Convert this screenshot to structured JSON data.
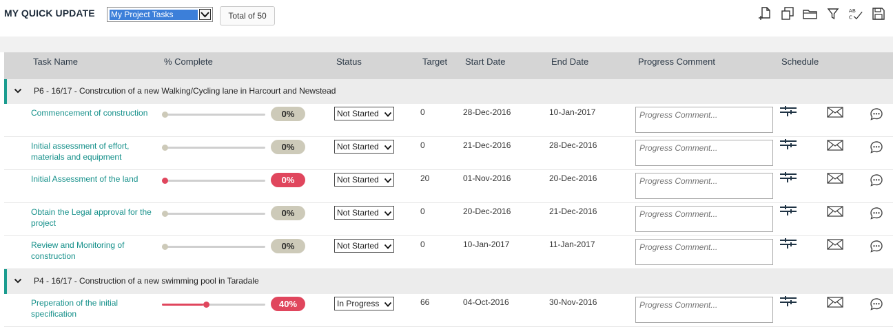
{
  "header": {
    "title": "MY QUICK UPDATE",
    "list_select_value": "My Project Tasks",
    "total_label": "Total of 50"
  },
  "toolbar": {
    "icons": [
      "add-page-icon",
      "copy-icon",
      "folder-icon",
      "filter-icon",
      "spellcheck-icon",
      "save-icon"
    ]
  },
  "columns": {
    "task_name": "Task Name",
    "percent_complete": "% Complete",
    "status": "Status",
    "target": "Target",
    "start_date": "Start Date",
    "end_date": "End Date",
    "progress_comment": "Progress Comment",
    "schedule": "Schedule"
  },
  "comment_placeholder": "Progress Comment...",
  "colors": {
    "accent_teal": "#1b9c8f",
    "task_link": "#15908a",
    "alert_red": "#e0465d",
    "neutral_badge": "#cdcab9"
  },
  "groups": [
    {
      "title": "P6 - 16/17 - Constrcution of a new Walking/Cycling lane in Harcourt and Newstead",
      "rows": [
        {
          "name": "Commencement of construction",
          "percent": 0,
          "percent_label": "0%",
          "alert": false,
          "status": "Not Started",
          "target": "0",
          "start": "28-Dec-2016",
          "end": "10-Jan-2017"
        },
        {
          "name": "Initial assessment of effort, materials and equipment",
          "percent": 0,
          "percent_label": "0%",
          "alert": false,
          "status": "Not Started",
          "target": "0",
          "start": "21-Dec-2016",
          "end": "28-Dec-2016"
        },
        {
          "name": "Initial Assessment of the land",
          "percent": 0,
          "percent_label": "0%",
          "alert": true,
          "status": "Not Started",
          "target": "20",
          "start": "01-Nov-2016",
          "end": "20-Dec-2016"
        },
        {
          "name": "Obtain the Legal approval for the project",
          "percent": 0,
          "percent_label": "0%",
          "alert": false,
          "status": "Not Started",
          "target": "0",
          "start": "20-Dec-2016",
          "end": "21-Dec-2016"
        },
        {
          "name": "Review and Monitoring of construction",
          "percent": 0,
          "percent_label": "0%",
          "alert": false,
          "status": "Not Started",
          "target": "0",
          "start": "10-Jan-2017",
          "end": "11-Jan-2017"
        }
      ]
    },
    {
      "title": "P4 - 16/17 - Construction of a new swimming pool in Taradale",
      "rows": [
        {
          "name": "Preperation of the initial specification",
          "percent": 40,
          "percent_label": "40%",
          "alert": true,
          "status": "In Progress",
          "target": "66",
          "start": "04-Oct-2016",
          "end": "30-Nov-2016"
        }
      ]
    }
  ]
}
